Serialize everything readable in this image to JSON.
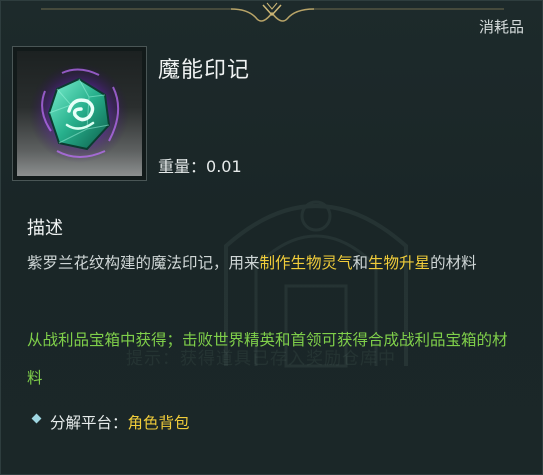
{
  "item": {
    "category": "消耗品",
    "name": "魔能印记",
    "weight_label": "重量：",
    "weight_value": "0.01"
  },
  "description": {
    "heading": "描述",
    "text_part1": "紫罗兰花纹构建的魔法印记，用来",
    "highlight1": "制作生物灵气",
    "text_part2": "和",
    "highlight2": "生物升星",
    "text_part3": "的材料"
  },
  "source": {
    "text": "从战利品宝箱中获得；击败世界精英和首领可获得合成战利品宝箱的材料"
  },
  "salvage": {
    "label": "分解平台：",
    "value": "角色背包"
  },
  "watermark_text": "提示：获得道具已存入奖励仓库中",
  "colors": {
    "highlight": "#f0cc3a",
    "source_green": "#7fcf4a",
    "background": "#1b2728"
  },
  "icons": {
    "item_icon": "purple-green-rune-gem-icon",
    "bullet": "diamond-bullet-icon",
    "ornament": "gold-filigree-ornament-icon"
  }
}
